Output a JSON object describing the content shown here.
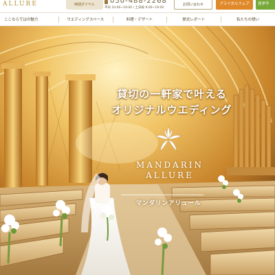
{
  "header": {
    "logo_text": "ALLURE",
    "hours_button": "時間ダイヤル",
    "phone_number": "050-488-2268",
    "phone_hours": "平日 10:00~19:00 / 土日祝 9:00~19:00",
    "inquiry_button": "お問い合わせ",
    "fair_button": "ブライダルフェア",
    "visit_button": "見学予"
  },
  "nav": {
    "items": [
      "ここならではの魅力",
      "ウエディングスペース",
      "料理・デザート",
      "挙式レポート",
      "私たちの想い"
    ]
  },
  "hero": {
    "headline_line1": "貸切の一軒家で叶える",
    "headline_line2": "オリジナルウエディング",
    "brand_name_line1": "MANDARIN",
    "brand_name_line2": "ALLURE",
    "brand_kana": "マンダリンアリュール",
    "icons": [
      "lily-logo-icon",
      "phone-icon"
    ]
  },
  "colors": {
    "accent_gold": "#b89238",
    "fair_orange": "#e0892a",
    "visit_green": "#77a83a",
    "chapel_gold": "#d9a441"
  }
}
